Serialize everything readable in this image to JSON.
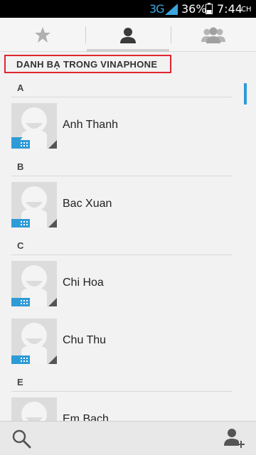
{
  "status_bar": {
    "network": "3G",
    "battery_percent": "36%",
    "time": "7:44",
    "ampm": "CH",
    "battery_level": 0.36
  },
  "tabs": [
    {
      "id": "favorites",
      "icon": "star-icon",
      "selected": false
    },
    {
      "id": "contacts",
      "icon": "person-icon",
      "selected": true
    },
    {
      "id": "groups",
      "icon": "group-icon",
      "selected": false
    }
  ],
  "account_header": "DANH BẠ TRONG VINAPHONE",
  "sections": [
    {
      "letter": "A",
      "contacts": [
        "Anh Thanh"
      ]
    },
    {
      "letter": "B",
      "contacts": [
        "Bac Xuan"
      ]
    },
    {
      "letter": "C",
      "contacts": [
        "Chi Hoa",
        "Chu Thu"
      ]
    },
    {
      "letter": "E",
      "contacts": [
        "Em Bach"
      ]
    }
  ],
  "bottom_bar": {
    "left_icon": "search-icon",
    "right_icon": "add-contact-icon"
  },
  "colors": {
    "accent": "#2e9bd6",
    "highlight_border": "#e0262e",
    "network_color": "#3aa6df"
  }
}
